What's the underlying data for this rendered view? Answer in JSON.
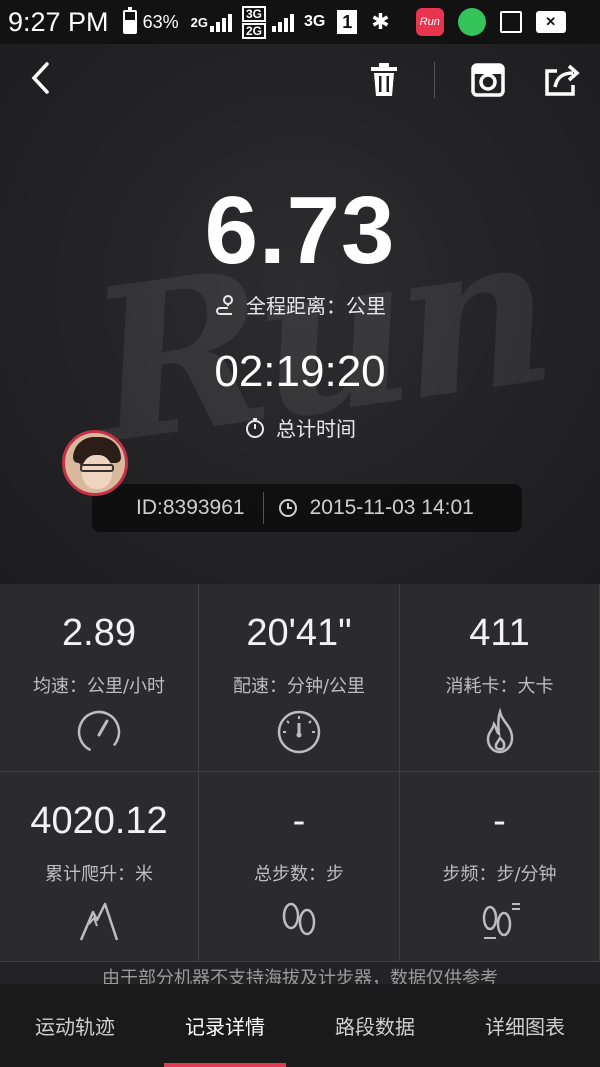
{
  "status_bar": {
    "time": "9:27 PM",
    "battery": "63%",
    "net1": "2G",
    "net2a": "3G",
    "net2b": "2G",
    "net3": "3G",
    "sim": "1",
    "bluetooth": "✱",
    "app_run": "Run"
  },
  "hero": {
    "background_word": "Run",
    "distance_value": "6.73",
    "distance_label": "全程距离：公里",
    "duration_value": "02:19:20",
    "duration_label": "总计时间",
    "user_id": "ID:8393961",
    "timestamp": "2015-11-03 14:01"
  },
  "stats": [
    {
      "value": "2.89",
      "label": "均速：公里/小时",
      "icon": "speedometer-icon"
    },
    {
      "value": "20'41\"",
      "label": "配速：分钟/公里",
      "icon": "pace-gauge-icon"
    },
    {
      "value": "411",
      "label": "消耗卡：大卡",
      "icon": "flame-icon"
    },
    {
      "value": "4020.12",
      "label": "累计爬升：米",
      "icon": "mountain-icon"
    },
    {
      "value": "-",
      "label": "总步数：步",
      "icon": "footprints-icon"
    },
    {
      "value": "-",
      "label": "步频：步/分钟",
      "icon": "footprints-rate-icon"
    }
  ],
  "note": "由于部分机器不支持海拔及计步器，数据仅供参考",
  "tabs": [
    {
      "label": "运动轨迹",
      "active": false
    },
    {
      "label": "记录详情",
      "active": true
    },
    {
      "label": "路段数据",
      "active": false
    },
    {
      "label": "详细图表",
      "active": false
    }
  ],
  "colors": {
    "accent": "#e13a52",
    "background": "#1c1c1e",
    "panel": "#2b2b2e"
  }
}
